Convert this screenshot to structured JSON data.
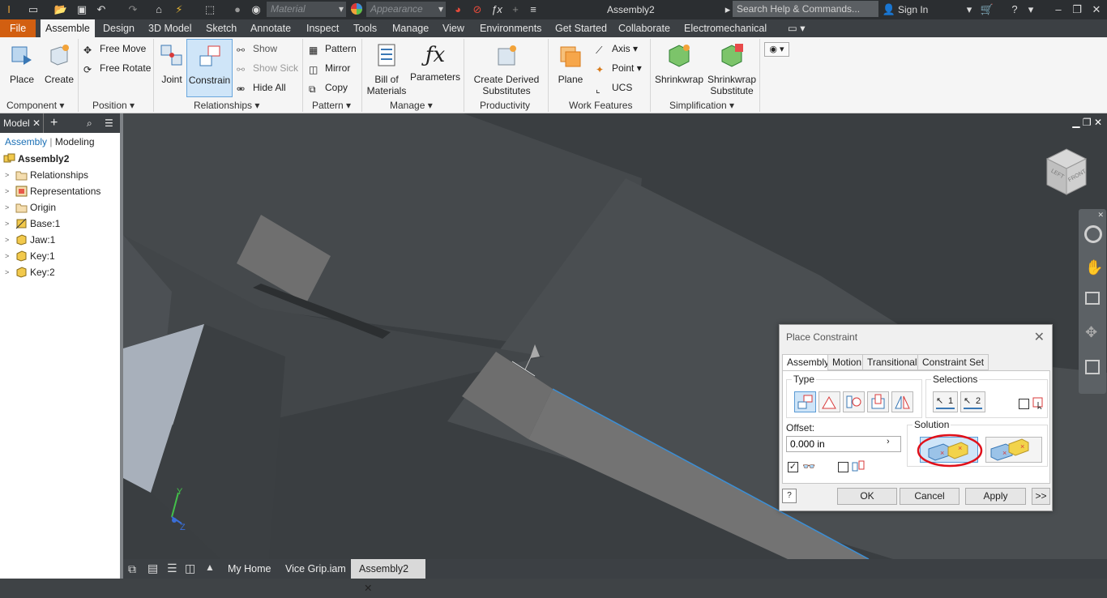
{
  "app": {
    "title": "Assembly2",
    "material_placeholder": "Material",
    "appearance_placeholder": "Appearance",
    "search_placeholder": "Search Help & Commands...",
    "sign_in": "Sign In"
  },
  "ribbon_tabs": [
    "File",
    "Assemble",
    "Design",
    "3D Model",
    "Sketch",
    "Annotate",
    "Inspect",
    "Tools",
    "Manage",
    "View",
    "Environments",
    "Get Started",
    "Collaborate",
    "Electromechanical"
  ],
  "ribbon": {
    "place": "Place",
    "create": "Create",
    "free_move": "Free Move",
    "free_rotate": "Free Rotate",
    "joint": "Joint",
    "constrain": "Constrain",
    "show": "Show",
    "show_sick": "Show Sick",
    "hide_all": "Hide All",
    "pattern": "Pattern",
    "mirror": "Mirror",
    "copy": "Copy",
    "bom_line1": "Bill of",
    "bom_line2": "Materials",
    "parameters": "Parameters",
    "cds_line1": "Create Derived",
    "cds_line2": "Substitutes",
    "plane": "Plane",
    "axis": "Axis",
    "point": "Point",
    "ucs": "UCS",
    "shrinkwrap": "Shrinkwrap",
    "sws_line1": "Shrinkwrap",
    "sws_line2": "Substitute",
    "panels": {
      "component": "Component",
      "position": "Position",
      "relationships": "Relationships",
      "pattern": "Pattern",
      "manage": "Manage",
      "productivity": "Productivity",
      "work_features": "Work Features",
      "simplification": "Simplification"
    }
  },
  "browser": {
    "tab": "Model",
    "view_assembly": "Assembly",
    "view_modeling": "Modeling",
    "root": "Assembly2",
    "items": [
      "Relationships",
      "Representations",
      "Origin",
      "Base:1",
      "Jaw:1",
      "Key:1",
      "Key:2"
    ]
  },
  "doc_tabs": {
    "home": "My Home",
    "vice": "Vice Grip.iam",
    "active": "Assembly2"
  },
  "viewcube": {
    "left": "LEFT",
    "front": "FRONT"
  },
  "triad": {
    "y": "Y",
    "z": "Z"
  },
  "dialog": {
    "title": "Place Constraint",
    "tabs": [
      "Assembly",
      "Motion",
      "Transitional",
      "Constraint Set"
    ],
    "type_label": "Type",
    "selections_label": "Selections",
    "sel1": "1",
    "sel2": "2",
    "offset_label": "Offset:",
    "offset_value": "0.000 in",
    "solution_label": "Solution",
    "ok": "OK",
    "cancel": "Cancel",
    "apply": "Apply",
    "more": ">>"
  },
  "colors": {
    "file_tab": "#d25f11",
    "highlight_circle": "#e0101a",
    "active_blue": "#cfe5f8"
  }
}
